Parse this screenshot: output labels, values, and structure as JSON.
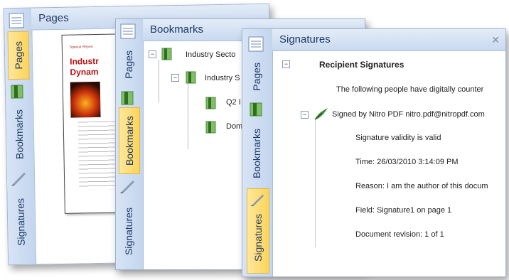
{
  "pages_panel": {
    "title": "Pages",
    "tabs": {
      "pages": "Pages",
      "bookmarks": "Bookmarks",
      "signatures": "Signatures"
    },
    "thumbnail": {
      "small_heading": "Special Report",
      "heading_line1": "Industr",
      "heading_line2": "Dynam"
    }
  },
  "bookmarks_panel": {
    "title": "Bookmarks",
    "tabs": {
      "pages": "Pages",
      "bookmarks": "Bookmarks",
      "signatures": "Signatures"
    },
    "tree": {
      "root": "Industry Secto",
      "child": "Industry S",
      "leaf1": "Q2 I",
      "leaf2": "Dom"
    }
  },
  "signatures_panel": {
    "title": "Signatures",
    "close": "✕",
    "tabs": {
      "pages": "Pages",
      "bookmarks": "Bookmarks",
      "signatures": "Signatures"
    },
    "section_title": "Recipient Signatures",
    "intro": "The following people have digitally counter",
    "signed_by": "Signed by Nitro PDF nitro.pdf@nitropdf.com",
    "details": {
      "validity": "Signature validity is valid",
      "time": "Time: 26/03/2010 3:14:09 PM",
      "reason": "Reason: I am the author of this docum",
      "field": "Field: Signature1 on page 1",
      "revision": "Document revision: 1 of 1"
    }
  },
  "colors": {
    "active_tab": "#fcd45a",
    "header": "#c9d9ef",
    "title_text": "#1e3a66"
  }
}
